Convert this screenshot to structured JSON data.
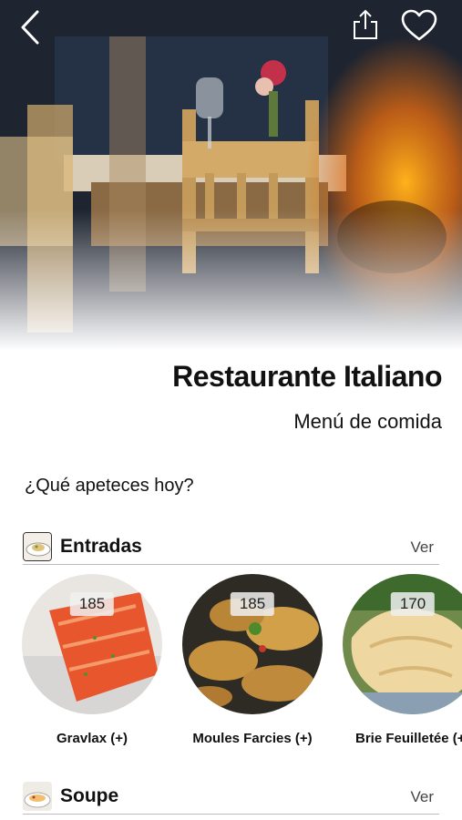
{
  "header": {
    "back_icon": "chevron-left-icon",
    "share_icon": "share-icon",
    "favorite_icon": "heart-outline-icon"
  },
  "restaurant": {
    "name": "Restaurante Italiano",
    "menu_label": "Menú de comida"
  },
  "prompt": "¿Qué apeteces hoy?",
  "sections": [
    {
      "title": "Entradas",
      "view_label": "Ver",
      "dishes": [
        {
          "name": "Gravlax (+)",
          "price": "185"
        },
        {
          "name": "Moules Farcies (+)",
          "price": "185"
        },
        {
          "name": "Brie Feuilletée (+",
          "price": "170"
        }
      ]
    },
    {
      "title": "Soupe",
      "view_label": "Ver"
    }
  ],
  "colors": {
    "text": "#111111",
    "divider": "#bdbdbd",
    "muted": "#444444"
  }
}
